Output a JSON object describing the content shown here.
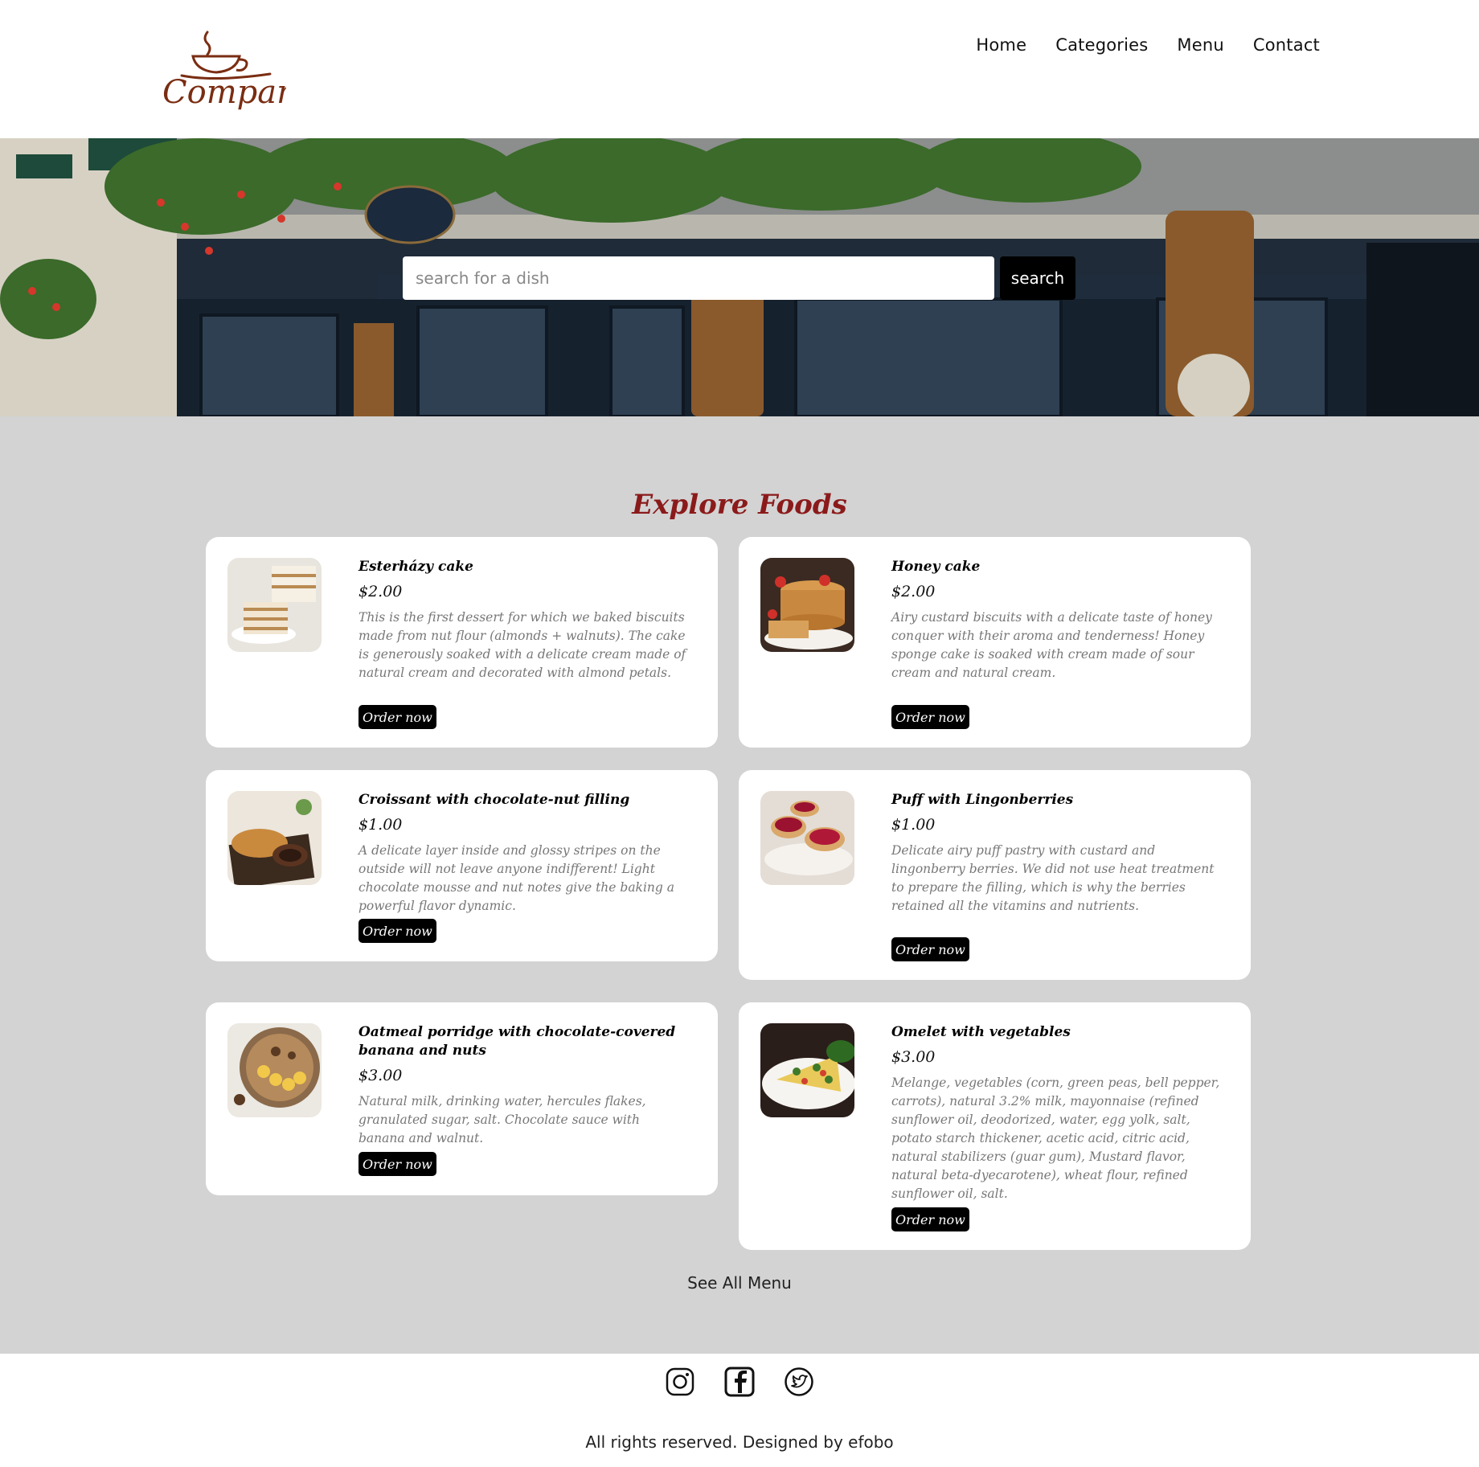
{
  "brand": {
    "logo_text": "Company",
    "color": "#7a2d12"
  },
  "nav": {
    "items": [
      "Home",
      "Categories",
      "Menu",
      "Contact"
    ]
  },
  "search": {
    "placeholder": "search for a dish",
    "button_label": "search"
  },
  "section": {
    "title": "Explore Foods",
    "title_color": "#8b1a1a"
  },
  "foods": [
    {
      "name": "Esterházy cake",
      "price": "$2.00",
      "description": "This is the first dessert for which we baked biscuits made from nut flour (almonds + walnuts). The cake is generously soaked with a delicate cream made of natural cream and decorated with almond petals.",
      "button": "Order now",
      "image_icon": "layered-cake-image"
    },
    {
      "name": "Honey cake",
      "price": "$2.00",
      "description": "Airy custard biscuits with a delicate taste of honey conquer with their aroma and tenderness! Honey sponge cake is soaked with cream made of sour cream and natural cream.",
      "button": "Order now",
      "image_icon": "honey-cake-image"
    },
    {
      "name": "Croissant with chocolate-nut filling",
      "price": "$1.00",
      "description": "A delicate layer inside and glossy stripes on the outside will not leave anyone indifferent! Light chocolate mousse and nut notes give the baking a powerful flavor dynamic.",
      "button": "Order now",
      "image_icon": "croissant-image"
    },
    {
      "name": "Puff with Lingonberries",
      "price": "$1.00",
      "description": "Delicate airy puff pastry with custard and lingonberry berries. We did not use heat treatment to prepare the filling, which is why the berries retained all the vitamins and nutrients.",
      "button": "Order now",
      "image_icon": "berry-tart-image"
    },
    {
      "name": "Oatmeal porridge with chocolate-covered banana and nuts",
      "price": "$3.00",
      "description": "Natural milk, drinking water, hercules flakes, granulated sugar, salt. Chocolate sauce with banana and walnut.",
      "button": "Order now",
      "image_icon": "porridge-bowl-image"
    },
    {
      "name": "Omelet with vegetables",
      "price": "$3.00",
      "description": "Melange, vegetables (corn, green peas, bell pepper, carrots), natural 3.2% milk, mayonnaise (refined sunflower oil, deodorized, water, egg yolk, salt, potato starch thickener, acetic acid, citric acid, natural stabilizers (guar gum), Mustard flavor, natural beta-dyecarotene), wheat flour, refined sunflower oil, salt.",
      "button": "Order now",
      "image_icon": "omelet-plate-image"
    }
  ],
  "see_all": "See All Menu",
  "footer": {
    "social": [
      "instagram-icon",
      "facebook-icon",
      "twitter-icon"
    ],
    "copyright": "All rights reserved. Designed by efobo"
  }
}
